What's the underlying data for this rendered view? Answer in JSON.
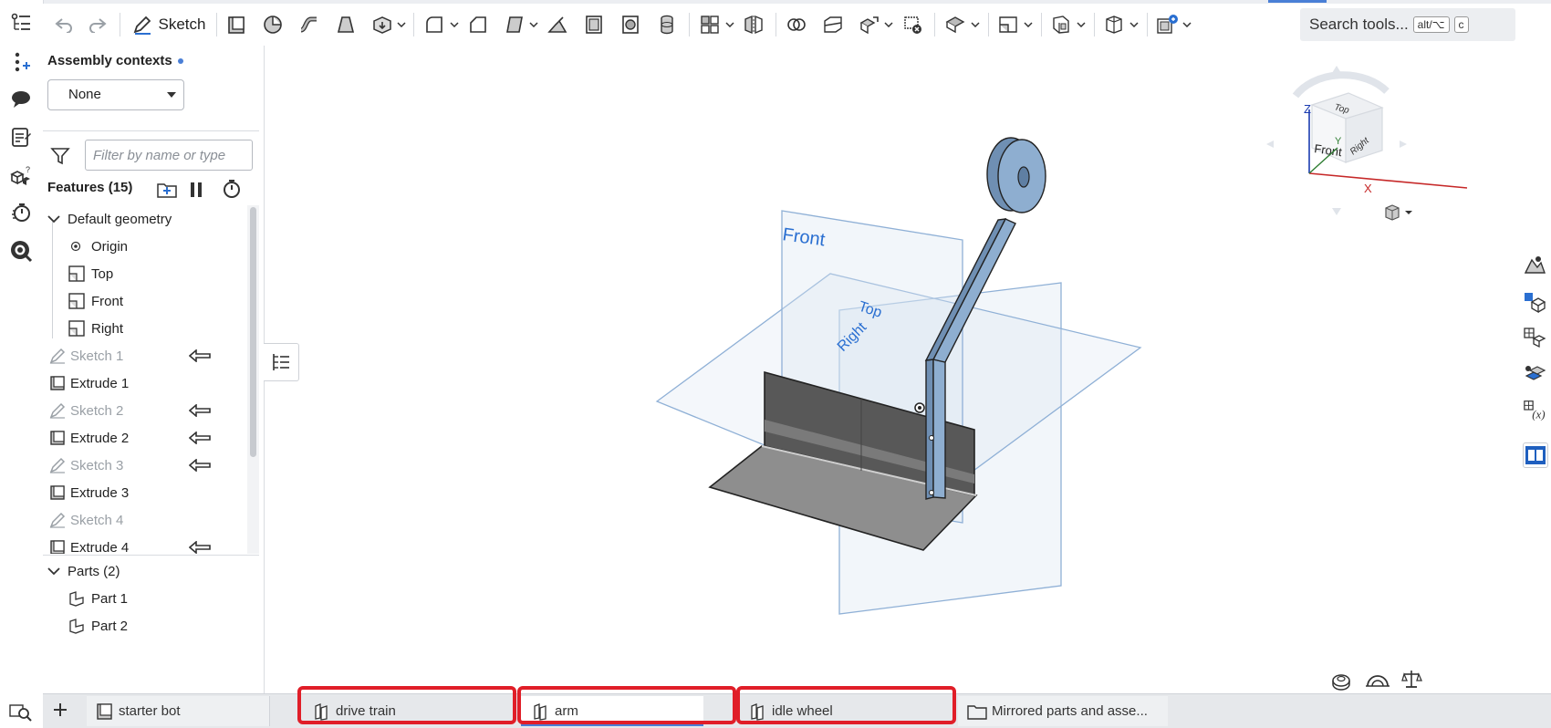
{
  "toolbar": {
    "sketch_label": "Sketch",
    "search_label": "Search tools...",
    "search_shortcut_1": "alt/⌥",
    "search_shortcut_2": "c"
  },
  "assembly_contexts": {
    "title": "Assembly contexts",
    "selected": "None"
  },
  "filter": {
    "placeholder": "Filter by name or type"
  },
  "features": {
    "header": "Features (15)",
    "default_geometry_label": "Default geometry",
    "items": [
      {
        "label": "Origin",
        "icon": "origin-icon",
        "dim": false
      },
      {
        "label": "Top",
        "icon": "plane-icon",
        "dim": false
      },
      {
        "label": "Front",
        "icon": "plane-icon",
        "dim": false
      },
      {
        "label": "Right",
        "icon": "plane-icon",
        "dim": false
      },
      {
        "label": "Sketch 1",
        "icon": "sketch-icon",
        "dim": true,
        "rollback": true
      },
      {
        "label": "Extrude 1",
        "icon": "extrude-icon",
        "dim": false
      },
      {
        "label": "Sketch 2",
        "icon": "sketch-icon",
        "dim": true,
        "rollback": true
      },
      {
        "label": "Extrude 2",
        "icon": "extrude-icon",
        "dim": false,
        "rollback": true
      },
      {
        "label": "Sketch 3",
        "icon": "sketch-icon",
        "dim": true,
        "rollback": true
      },
      {
        "label": "Extrude 3",
        "icon": "extrude-icon",
        "dim": false
      },
      {
        "label": "Sketch 4",
        "icon": "sketch-icon",
        "dim": true
      },
      {
        "label": "Extrude 4",
        "icon": "extrude-icon",
        "dim": false,
        "rollback": true
      }
    ]
  },
  "parts": {
    "header": "Parts (2)",
    "items": [
      {
        "label": "Part 1"
      },
      {
        "label": "Part 2"
      }
    ]
  },
  "viewport": {
    "plane_front": "Front",
    "plane_top": "Top",
    "plane_right": "Right",
    "cube_front": "Front",
    "cube_top": "Top",
    "cube_right": "Right",
    "axis_x": "X",
    "axis_y": "Y",
    "axis_z": "Z"
  },
  "tabs": [
    {
      "label": "starter bot",
      "icon": "partstudio-doc-icon"
    },
    {
      "label": "drive train",
      "icon": "assembly-icon"
    },
    {
      "label": "arm",
      "icon": "assembly-icon",
      "active": true
    },
    {
      "label": "idle wheel",
      "icon": "assembly-icon"
    },
    {
      "label": "Mirrored parts and asse...",
      "icon": "folder-icon"
    }
  ],
  "colors": {
    "accent": "#4a7fd6",
    "highlight": "#e01e28",
    "plane": "#7aa5d6",
    "part_blue": "#7d9ec0",
    "part_gray": "#8e8e8e"
  }
}
